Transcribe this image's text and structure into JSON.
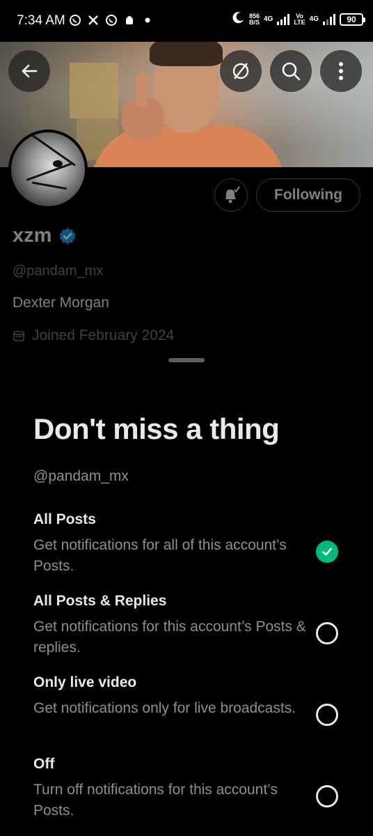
{
  "status_bar": {
    "time": "7:34 AM",
    "speed_value": "856",
    "speed_unit": "B/S",
    "net1": "4G",
    "net2_top": "Vo",
    "net2_bottom": "LTE",
    "net3": "4G",
    "battery": "90",
    "icons": [
      "whatsapp-icon",
      "x-icon",
      "whatsapp-icon",
      "android-icon",
      "dot-icon",
      "moon-icon"
    ]
  },
  "header": {
    "icons": [
      "back-arrow-icon",
      "hide-icon",
      "search-icon",
      "more-icon"
    ]
  },
  "profile": {
    "name": "xzm",
    "handle": "@pandam_mx",
    "bio": "Dexter Morgan",
    "joined": "Joined February 2024",
    "following_label": "Following",
    "verified_color": "#1d9bf0"
  },
  "sheet": {
    "title": "Don't miss a thing",
    "handle": "@pandam_mx",
    "options": [
      {
        "title": "All Posts",
        "description": "Get notifications for all of this account’s Posts.",
        "selected": true
      },
      {
        "title": "All Posts & Replies",
        "description": "Get notifications for this account’s Posts & replies.",
        "selected": false
      },
      {
        "title": "Only live video",
        "description": "Get notifications only for live broadcasts.",
        "selected": false
      },
      {
        "title": "Off",
        "description": "Turn off notifications for this account’s Posts.",
        "selected": false
      }
    ],
    "selected_color": "#00ba7c"
  }
}
